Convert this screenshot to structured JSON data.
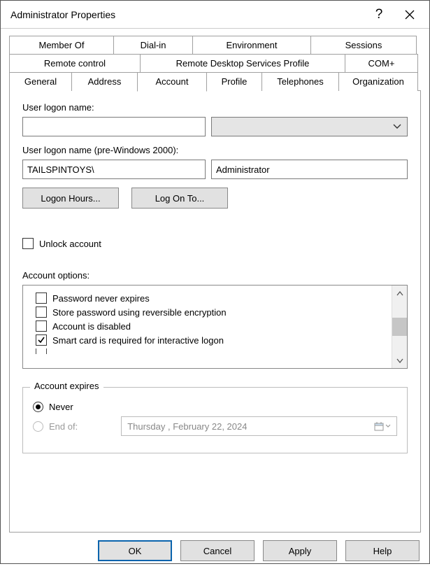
{
  "window": {
    "title": "Administrator Properties"
  },
  "tabs": {
    "row1": [
      "Member Of",
      "Dial-in",
      "Environment",
      "Sessions"
    ],
    "row2": [
      "Remote control",
      "Remote Desktop Services Profile",
      "COM+"
    ],
    "row3": [
      "General",
      "Address",
      "Account",
      "Profile",
      "Telephones",
      "Organization"
    ],
    "active": "Account"
  },
  "account": {
    "logon_label": "User logon name:",
    "logon_value": "",
    "prewin_label": "User logon name (pre-Windows 2000):",
    "prewin_domain": "TAILSPINTOYS\\",
    "prewin_user": "Administrator",
    "logon_hours_btn": "Logon Hours...",
    "log_on_to_btn": "Log On To...",
    "unlock_label": "Unlock account",
    "unlock_checked": false,
    "options_label": "Account options:",
    "options": [
      {
        "label": "Password never expires",
        "checked": false
      },
      {
        "label": "Store password using reversible encryption",
        "checked": false
      },
      {
        "label": "Account is disabled",
        "checked": false
      },
      {
        "label": "Smart card is required for interactive logon",
        "checked": true
      }
    ],
    "expires_legend": "Account expires",
    "expires_never": "Never",
    "expires_endof": "End of:",
    "expires_date": "Thursday ,   February  22, 2024",
    "expires_selected": "never"
  },
  "footer": {
    "ok": "OK",
    "cancel": "Cancel",
    "apply": "Apply",
    "help": "Help"
  }
}
